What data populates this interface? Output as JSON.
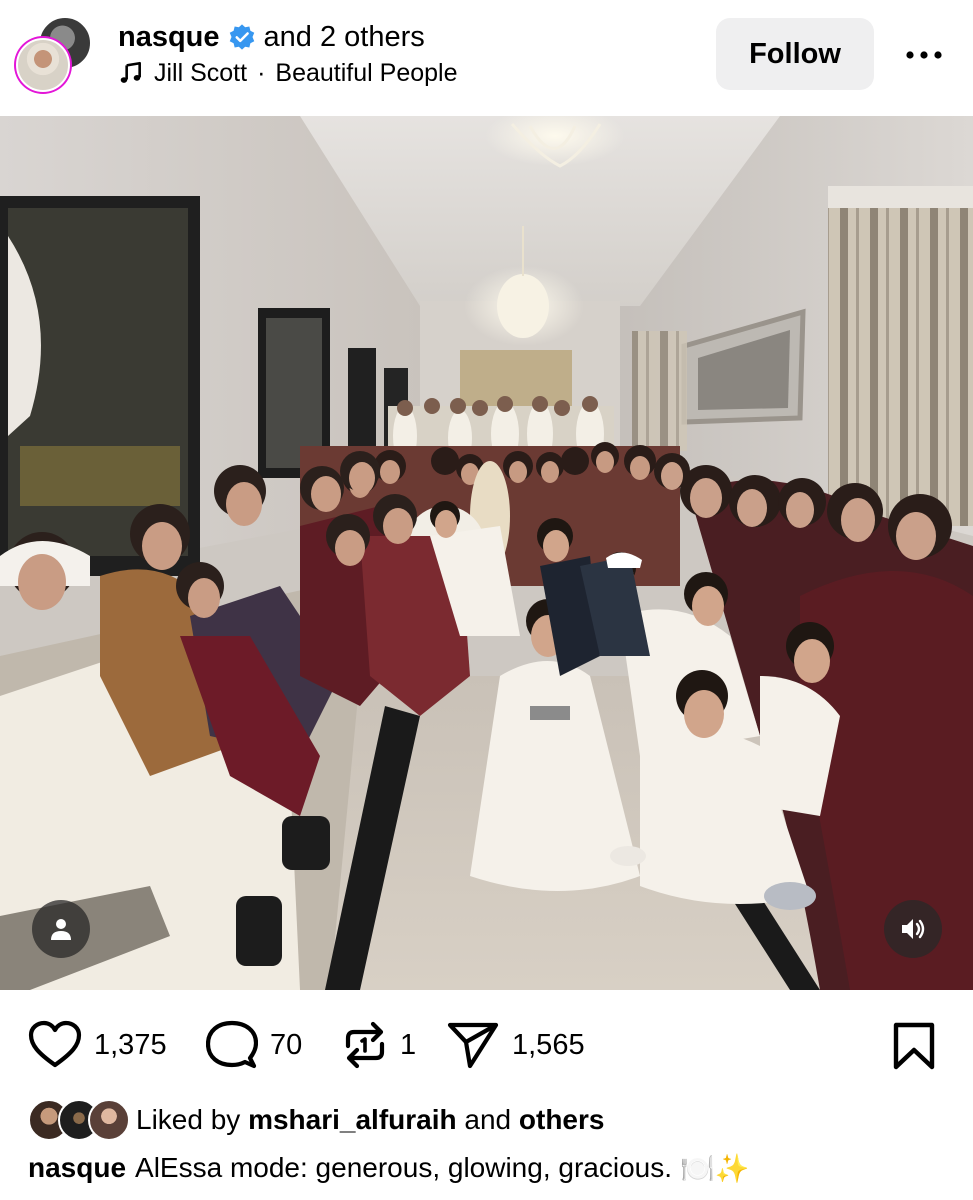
{
  "header": {
    "username": "nasque",
    "co_authors": "and 2 others",
    "audio_artist": "Jill Scott",
    "audio_separator": "·",
    "audio_track": "Beautiful People",
    "follow_label": "Follow",
    "icons": {
      "verified": "verified-badge-icon",
      "audio": "music-note-icon",
      "more": "more-options-icon"
    },
    "colors": {
      "verified": "#3797f0",
      "story_ring": "#e316d8",
      "follow_bg": "#efeff0"
    }
  },
  "post": {
    "media": "group photo",
    "overlay_icons": {
      "user_tags": "person-icon",
      "audio": "speaker-icon"
    }
  },
  "actions": {
    "likes_count": "1,375",
    "comments_count": "70",
    "reposts_count": "1",
    "shares_count": "1,565",
    "icons": [
      "heart-icon",
      "comment-icon",
      "repost-icon",
      "share-icon",
      "bookmark-icon"
    ]
  },
  "likes": {
    "prefix": "Liked by",
    "first_liker": "mshari_alfuraih",
    "connector": "and",
    "others": "others"
  },
  "caption": {
    "username": "nasque",
    "text": "AlEssa mode: generous, glowing, gracious.",
    "emojis": "🍽️✨"
  }
}
